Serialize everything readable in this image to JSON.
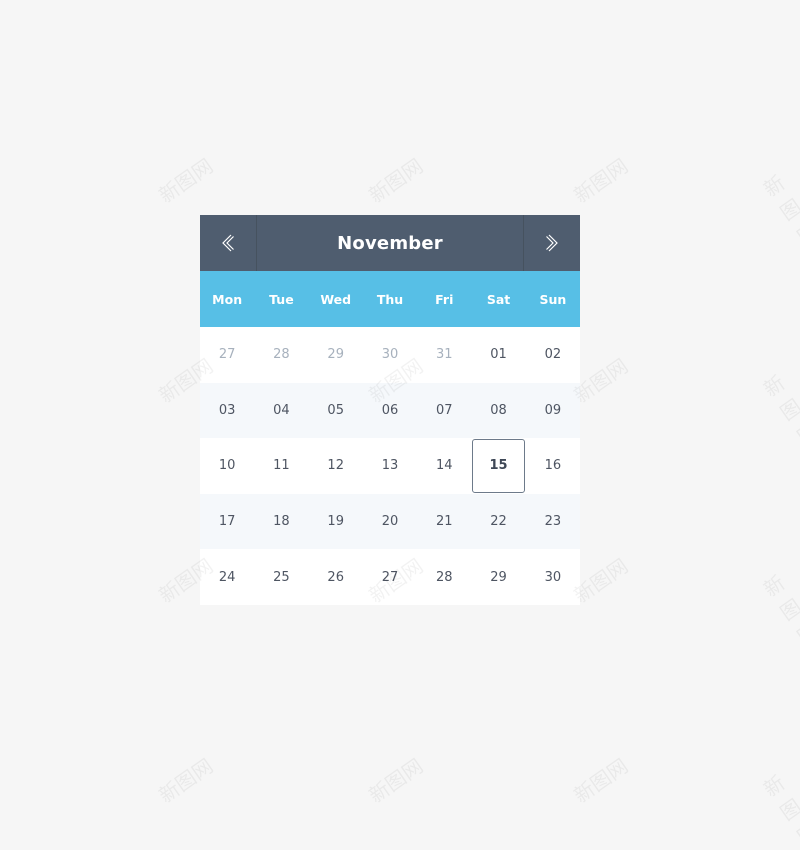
{
  "calendar": {
    "month": "November",
    "prev_icon": "chevron-left-icon",
    "next_icon": "chevron-right-icon",
    "weekdays": [
      "Mon",
      "Tue",
      "Wed",
      "Thu",
      "Fri",
      "Sat",
      "Sun"
    ],
    "weeks": [
      [
        {
          "d": "27",
          "muted": true
        },
        {
          "d": "28",
          "muted": true
        },
        {
          "d": "29",
          "muted": true
        },
        {
          "d": "30",
          "muted": true
        },
        {
          "d": "31",
          "muted": true
        },
        {
          "d": "01"
        },
        {
          "d": "02"
        }
      ],
      [
        {
          "d": "03"
        },
        {
          "d": "04"
        },
        {
          "d": "05"
        },
        {
          "d": "06"
        },
        {
          "d": "07"
        },
        {
          "d": "08"
        },
        {
          "d": "09"
        }
      ],
      [
        {
          "d": "10"
        },
        {
          "d": "11"
        },
        {
          "d": "12"
        },
        {
          "d": "13"
        },
        {
          "d": "14"
        },
        {
          "d": "15",
          "selected": true
        },
        {
          "d": "16"
        }
      ],
      [
        {
          "d": "17"
        },
        {
          "d": "18"
        },
        {
          "d": "19"
        },
        {
          "d": "20"
        },
        {
          "d": "21"
        },
        {
          "d": "22"
        },
        {
          "d": "23"
        }
      ],
      [
        {
          "d": "24"
        },
        {
          "d": "25"
        },
        {
          "d": "26"
        },
        {
          "d": "27"
        },
        {
          "d": "28"
        },
        {
          "d": "29"
        },
        {
          "d": "30"
        }
      ]
    ],
    "selected_day": "15"
  },
  "colors": {
    "header_bg": "#4f5d6f",
    "weekday_bg": "#57bfe6",
    "alt_row_bg": "#f5f8fb",
    "muted_text": "#a7b1bd",
    "text": "#4e5562"
  },
  "watermark_text": "新图网"
}
